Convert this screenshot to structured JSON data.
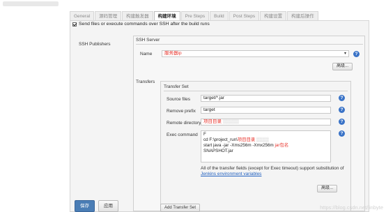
{
  "breadcrumb": "",
  "tabs": [
    {
      "label": "General"
    },
    {
      "label": "源码管理"
    },
    {
      "label": "构建触发器"
    },
    {
      "label": "构建环境"
    },
    {
      "label": "Pre Steps"
    },
    {
      "label": "Build"
    },
    {
      "label": "Post Steps"
    },
    {
      "label": "构建设置"
    },
    {
      "label": "构建后操作"
    }
  ],
  "send_checkbox_label": "Send files or execute commands over SSH after the build runs",
  "ssh_publishers_label": "SSH Publishers",
  "ssh_server": {
    "heading": "SSH Server",
    "name_label": "Name",
    "name_value": "服务器ip",
    "advanced": "高级..."
  },
  "transfers": {
    "label": "Transfers",
    "set_heading": "Transfer Set",
    "source_files_label": "Source files",
    "source_files_value": "target/*.jar",
    "remove_prefix_label": "Remove prefix",
    "remove_prefix_value": "target",
    "remote_directory_label": "Remote directory",
    "remote_directory_value": "项目目录",
    "exec_command_label": "Exec command",
    "exec_lines": [
      "F",
      "cd F:\\project_run\\",
      "项目目录",
      "start java -jar -Xms256m -Xmx256m",
      "jar包名",
      "SNAPSHOT.jar"
    ],
    "note": "All of the transfer fields (except for Exec timeout) support substitution of",
    "note_link": "Jenkins environment variables",
    "advanced": "高级...",
    "add_button": "Add Transfer Set"
  },
  "buttons": {
    "save": "保存",
    "apply": "应用"
  },
  "watermark": "https://blog.csdn.net/linbyte",
  "colors": {
    "annotation": "#e8322a",
    "help": "#3a73c7",
    "save_bg": "#4a7db5"
  }
}
